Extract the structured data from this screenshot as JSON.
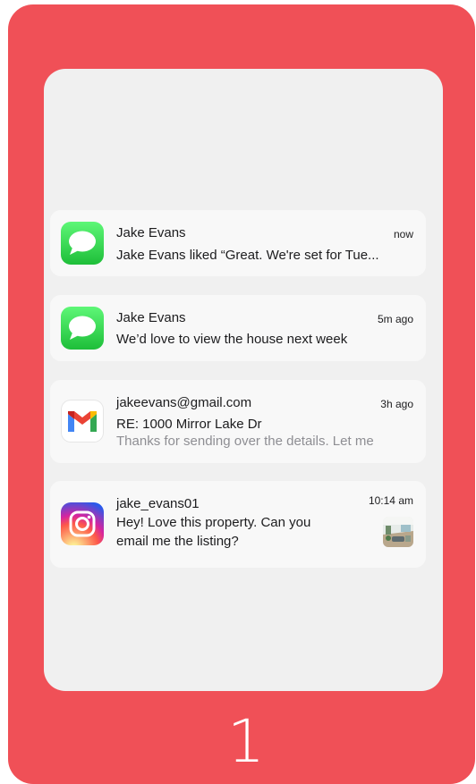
{
  "notifications": [
    {
      "app": "messages-icon",
      "sender": "Jake Evans",
      "time": "now",
      "line1": "Jake Evans liked “Great. We're set for Tue..."
    },
    {
      "app": "messages-icon",
      "sender": "Jake Evans",
      "time": "5m ago",
      "line1": "We’d love to view the house next week"
    },
    {
      "app": "gmail-icon",
      "sender": "jakeevans@gmail.com",
      "time": "3h ago",
      "line1": "RE: 1000 Mirror Lake Dr",
      "line2": "Thanks for sending over the details. Let me"
    },
    {
      "app": "instagram-icon",
      "sender": "jake_evans01",
      "time": "10:14 am",
      "line1": "Hey! Love this property. Can you",
      "line2": "email me the listing?"
    }
  ],
  "page_number": "1",
  "colors": {
    "card": "#f05057",
    "screen": "#f0f0f0",
    "notification": "#f8f8f8",
    "text": "#1c1c1e",
    "muted": "#8e8e93"
  }
}
